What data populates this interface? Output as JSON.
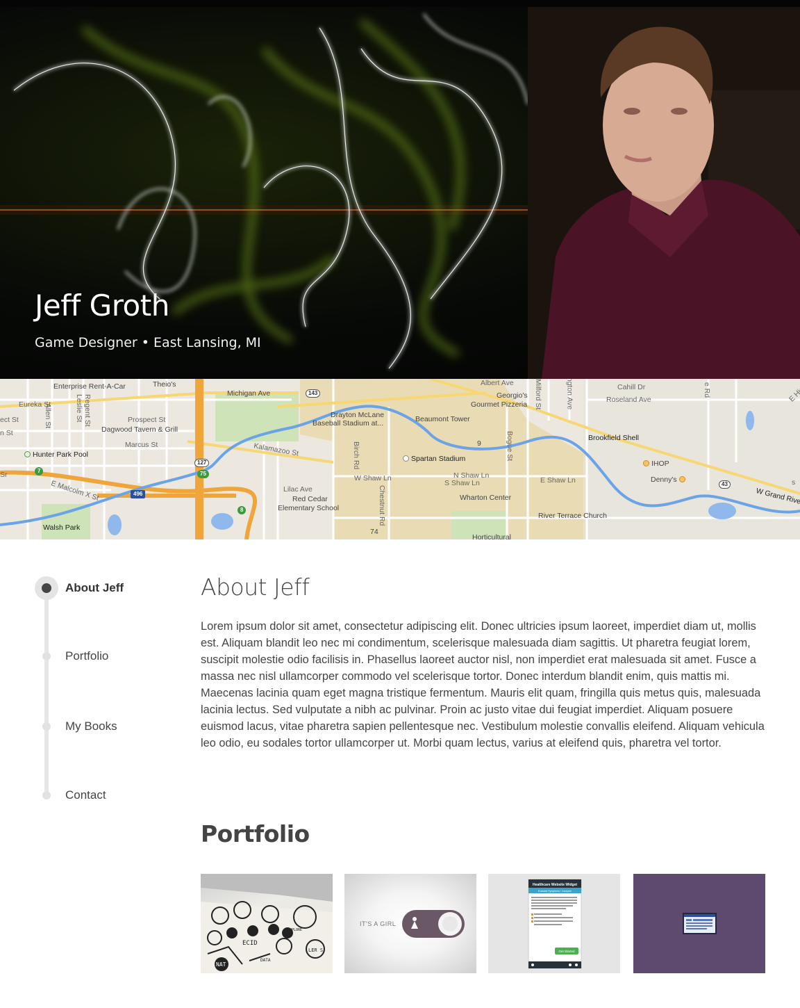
{
  "hero": {
    "name": "Jeff Groth",
    "subtitle": "Game Designer • East Lansing, MI"
  },
  "map": {
    "labels": {
      "enterprise": "Enterprise Rent-A-Car",
      "theios": "Theio's",
      "michigan_ave": "Michigan Ave",
      "eureka": "Eureka St",
      "allen": "Allen St",
      "regent": "Regent St",
      "leslie": "Leslie St",
      "prospect": "Prospect St",
      "dagwood": "Dagwood Tavern & Grill",
      "marcus": "Marcus St",
      "hunter": "Hunter Park Pool",
      "kalamazoo": "Kalamazoo St",
      "malcolm": "E Malcolm X St",
      "walsh": "Walsh Park",
      "lilac": "Lilac Ave",
      "red_cedar": "Red Cedar",
      "elementary": "Elementary School",
      "drayton": "Drayton McLane",
      "baseball": "Baseball Stadium at...",
      "beaumont": "Beaumont Tower",
      "georgios": "Georgio's",
      "gourmet": "Gourmet Pizzeria",
      "albert": "Albert Ave",
      "birch": "Birch Rd",
      "spartan": "Spartan Stadium",
      "w_shaw": "W Shaw Ln",
      "n_shaw": "N Shaw Ln",
      "s_shaw": "S Shaw Ln",
      "chestnut": "Chestnut Rd",
      "bogue": "Bogue St",
      "wharton": "Wharton Center",
      "horticultural": "Horticultural",
      "milford": "Milford St",
      "cahill": "Cahill Dr",
      "roseland": "Roseland Ave",
      "brookfield": "Brookfield Shell",
      "ihop": "IHOP",
      "dennys": "Denny's",
      "e_shaw": "E Shaw Ln",
      "river_terrace": "River Terrace Church",
      "w_grand": "W Grand Rive",
      "e_hidden": "E Hidden",
      "ect_st": "ect St",
      "n_st": "n St",
      "sr": "Sr",
      "ngton_ave": "ngton Ave",
      "e_rd": "e Rd",
      "s": "s"
    },
    "shields": {
      "r143": "143",
      "r127": "127",
      "r75": "75",
      "r496": "496",
      "r7": "7",
      "r8": "8",
      "r9": "9",
      "r43": "43",
      "r74": "74"
    }
  },
  "nav": {
    "items": [
      {
        "label": "About Jeff",
        "active": true
      },
      {
        "label": "Portfolio",
        "active": false
      },
      {
        "label": "My Books",
        "active": false
      },
      {
        "label": "Contact",
        "active": false
      }
    ]
  },
  "about": {
    "heading": "About Jeff",
    "body": "Lorem ipsum dolor sit amet, consectetur adipiscing elit. Donec ultricies ipsum laoreet, imperdiet diam ut, mollis est. Aliquam blandit leo nec mi condimentum, scelerisque malesuada diam sagittis. Ut pharetra feugiat lorem, suscipit molestie odio facilisis in. Phasellus laoreet auctor nisl, non imperdiet erat malesuada sit amet. Fusce a massa nec nisl ullamcorper commodo vel scelerisque tortor. Donec interdum blandit enim, quis mattis mi. Maecenas lacinia quam eget magna tristique fermentum. Mauris elit quam, fringilla quis metus quis, malesuada lacinia lectus. Sed vulputate a nibh ac pulvinar. Proin ac justo vitae dui feugiat imperdiet. Aliquam posuere euismod lacus, vitae pharetra sapien pellentesque nec. Vestibulum molestie convallis eleifend. Aliquam vehicula leo odio, eu sodales tortor ullamcorper ut. Morbi quam lectus, varius at eleifend quis, pharetra vel tortor."
  },
  "portfolio": {
    "heading": "Portfolio",
    "thumbs": {
      "t1_words": [
        "ECID",
        "NAT",
        "LER S",
        "EXPLORE",
        "DATA"
      ],
      "t2_label": "IT'S A GIRL",
      "t3_title": "Healthcare Website Widget",
      "t3_tab": "Evaluate Symptoms / Compare",
      "t3_button": "Get Started"
    }
  },
  "colors": {
    "nav_active_dot": "#444444",
    "nav_line": "#e6e6e6",
    "thumb4_bg": "#5d4a6e",
    "map_water": "#6aa3e6",
    "map_highway": "#f0a53a",
    "map_campus": "#e6dab0"
  }
}
